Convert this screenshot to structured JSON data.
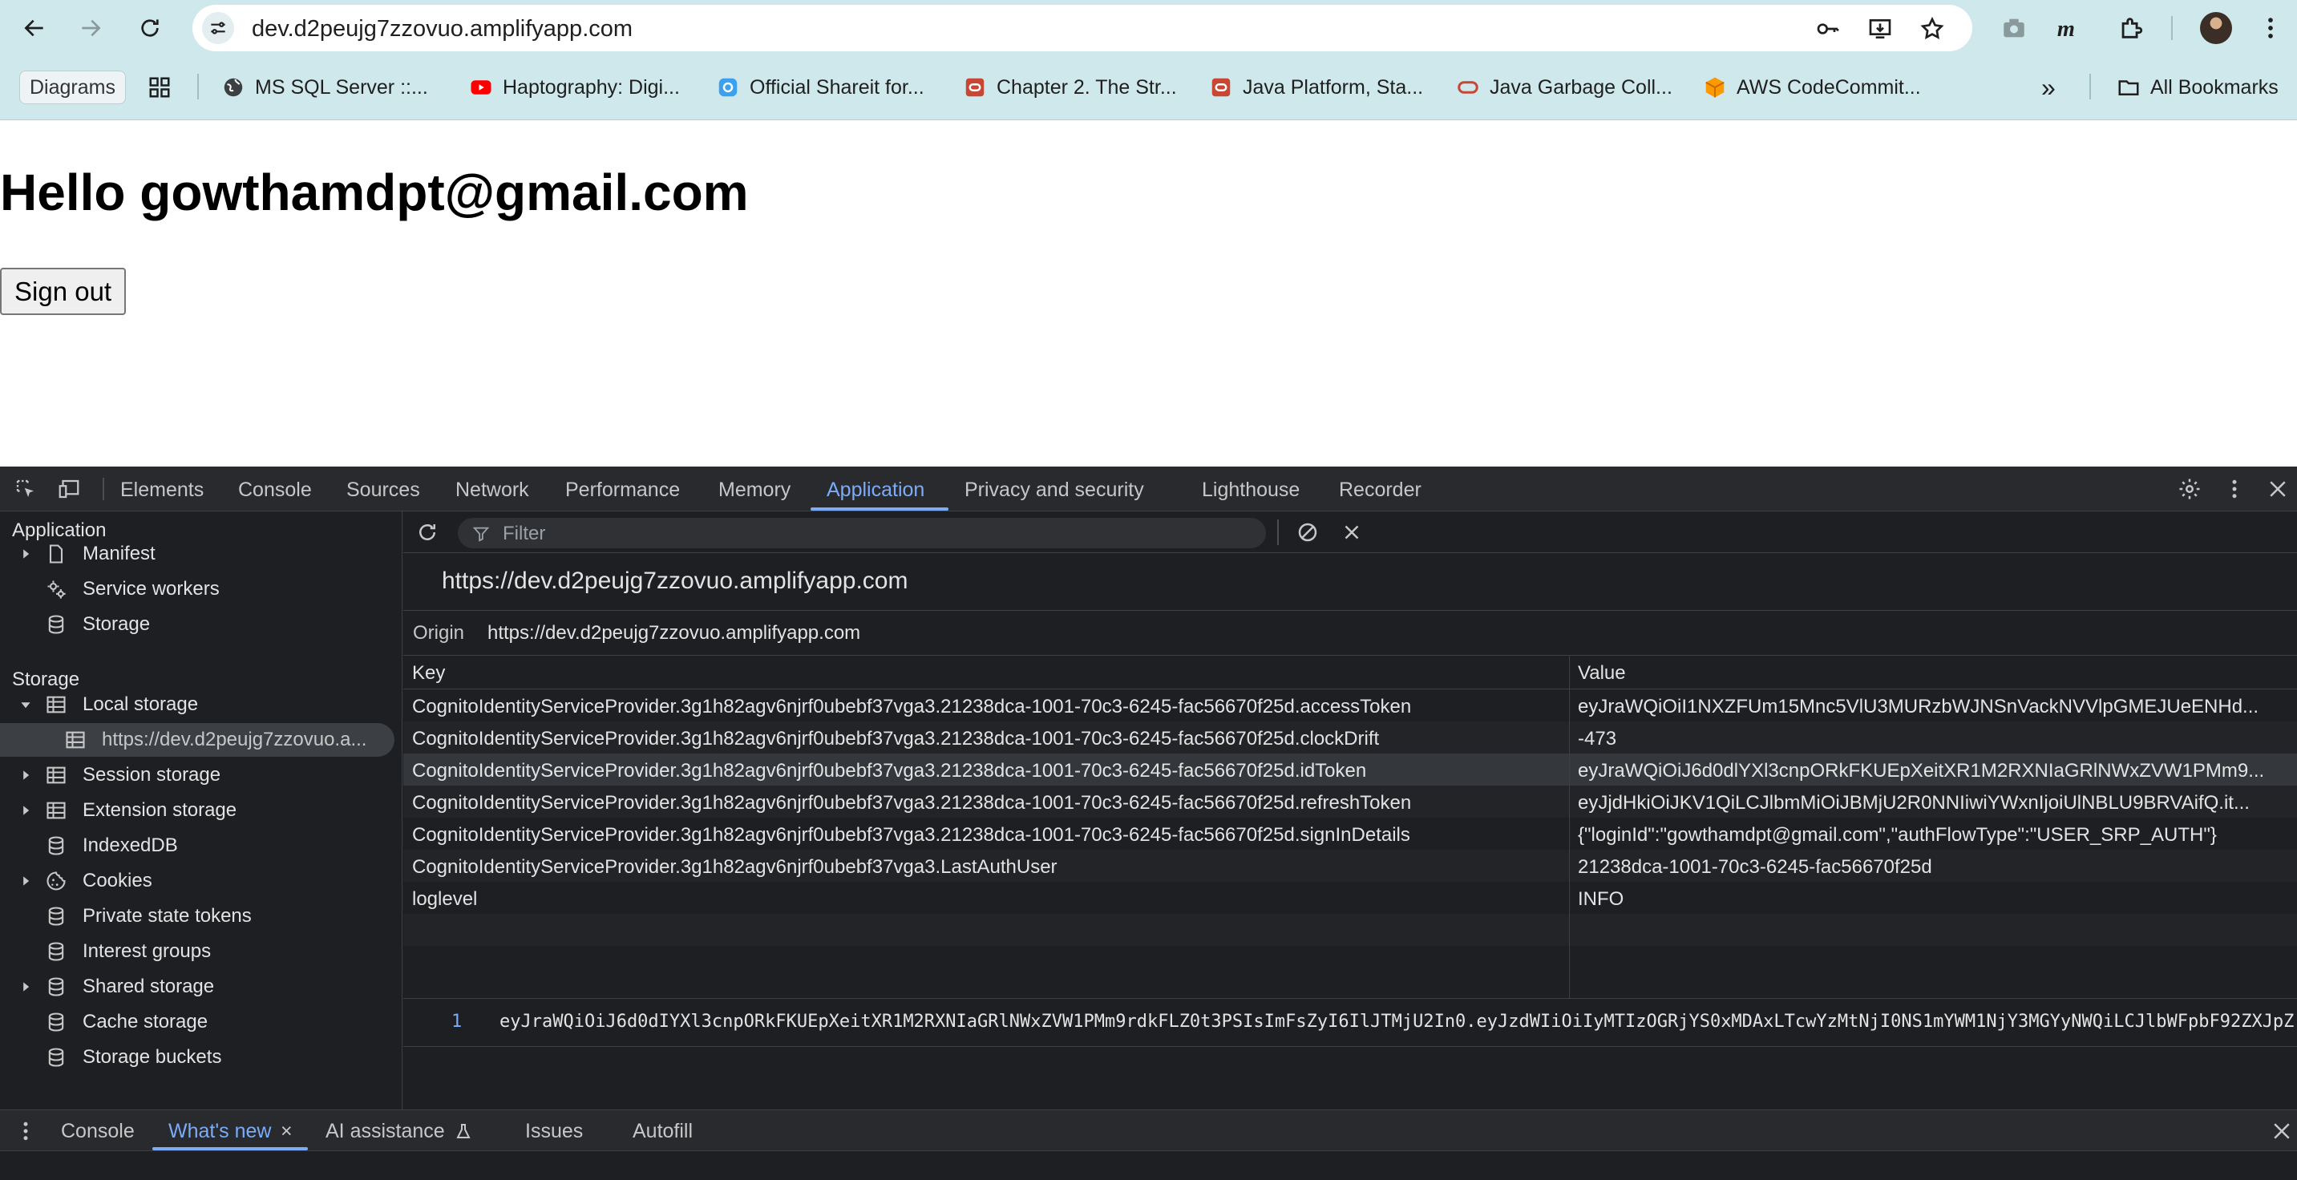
{
  "browser": {
    "url": "dev.d2peujg7zzovuo.amplifyapp.com",
    "bookmarks": {
      "diagrams_chip": "Diagrams",
      "items": [
        {
          "label": "MS SQL Server ::...",
          "icon": "globe-icon"
        },
        {
          "label": "Haptography: Digi...",
          "icon": "youtube-icon"
        },
        {
          "label": "Official Shareit for...",
          "icon": "shareit-icon"
        },
        {
          "label": "Chapter 2. The Str...",
          "icon": "oracle-icon"
        },
        {
          "label": "Java Platform, Sta...",
          "icon": "oracle-icon"
        },
        {
          "label": "Java Garbage Coll...",
          "icon": "oracle-outline-icon"
        },
        {
          "label": "AWS CodeCommit...",
          "icon": "aws-cube-icon"
        }
      ],
      "overflow": "»",
      "all_bookmarks": "All Bookmarks"
    }
  },
  "page": {
    "heading": "Hello gowthamdpt@gmail.com",
    "sign_out": "Sign out"
  },
  "devtools": {
    "tabs": [
      "Elements",
      "Console",
      "Sources",
      "Network",
      "Performance",
      "Memory",
      "Application",
      "Privacy and security",
      "Lighthouse",
      "Recorder"
    ],
    "active_tab": "Application",
    "sidebar": {
      "application_heading": "Application",
      "application_items": [
        "Manifest",
        "Service workers",
        "Storage"
      ],
      "storage_heading": "Storage",
      "storage_items": [
        "Local storage",
        "https://dev.d2peujg7zzovuo.a...",
        "Session storage",
        "Extension storage",
        "IndexedDB",
        "Cookies",
        "Private state tokens",
        "Interest groups",
        "Shared storage",
        "Cache storage",
        "Storage buckets"
      ]
    },
    "filter_placeholder": "Filter",
    "origin_title": "https://dev.d2peujg7zzovuo.amplifyapp.com",
    "origin_label": "Origin",
    "origin_value": "https://dev.d2peujg7zzovuo.amplifyapp.com",
    "table": {
      "headers": [
        "Key",
        "Value"
      ],
      "rows": [
        {
          "key": "CognitoIdentityServiceProvider.3g1h82agv6njrf0ubebf37vga3.21238dca-1001-70c3-6245-fac56670f25d.accessToken",
          "value": "eyJraWQiOiI1NXZFUm15Mnc5VlU3MURzbWJNSnVackNVVlpGMEJUeENHd..."
        },
        {
          "key": "CognitoIdentityServiceProvider.3g1h82agv6njrf0ubebf37vga3.21238dca-1001-70c3-6245-fac56670f25d.clockDrift",
          "value": "-473"
        },
        {
          "key": "CognitoIdentityServiceProvider.3g1h82agv6njrf0ubebf37vga3.21238dca-1001-70c3-6245-fac56670f25d.idToken",
          "value": "eyJraWQiOiJ6d0dlYXl3cnpORkFKUEpXeitXR1M2RXNIaGRlNWxZVW1PMm9..."
        },
        {
          "key": "CognitoIdentityServiceProvider.3g1h82agv6njrf0ubebf37vga3.21238dca-1001-70c3-6245-fac56670f25d.refreshToken",
          "value": "eyJjdHkiOiJKV1QiLCJlbmMiOiJBMjU2R0NNIiwiYWxnIjoiUlNBLU9BRVAifQ.it..."
        },
        {
          "key": "CognitoIdentityServiceProvider.3g1h82agv6njrf0ubebf37vga3.21238dca-1001-70c3-6245-fac56670f25d.signInDetails",
          "value": "{\"loginId\":\"gowthamdpt@gmail.com\",\"authFlowType\":\"USER_SRP_AUTH\"}"
        },
        {
          "key": "CognitoIdentityServiceProvider.3g1h82agv6njrf0ubebf37vga3.LastAuthUser",
          "value": "21238dca-1001-70c3-6245-fac56670f25d"
        },
        {
          "key": "loglevel",
          "value": "INFO"
        }
      ],
      "selected_row": 2
    },
    "preview": {
      "line_number": "1",
      "text": "eyJraWQiOiJ6d0dIYXl3cnpORkFKUEpXeitXR1M2RXNIaGRlNWxZVW1PMm9rdkFLZ0t3PSIsImFsZyI6IlJTMjU2In0.eyJzdWIiOiIyMTIzOGRjYS0xMDAxLTcwYzMtNjI0NS1mYWM1NjY3MGYyNWQiLCJlbWFpbF92ZXJpZ"
    },
    "drawer": {
      "tabs": [
        "Console",
        "What's new",
        "AI assistance",
        "Issues",
        "Autofill"
      ],
      "active_tab": "What's new",
      "close_glyph": "×"
    },
    "colors": {
      "accent": "#7cacf8",
      "panel_bg": "#1e1f22",
      "toolbar_bg": "#282a2d"
    }
  }
}
